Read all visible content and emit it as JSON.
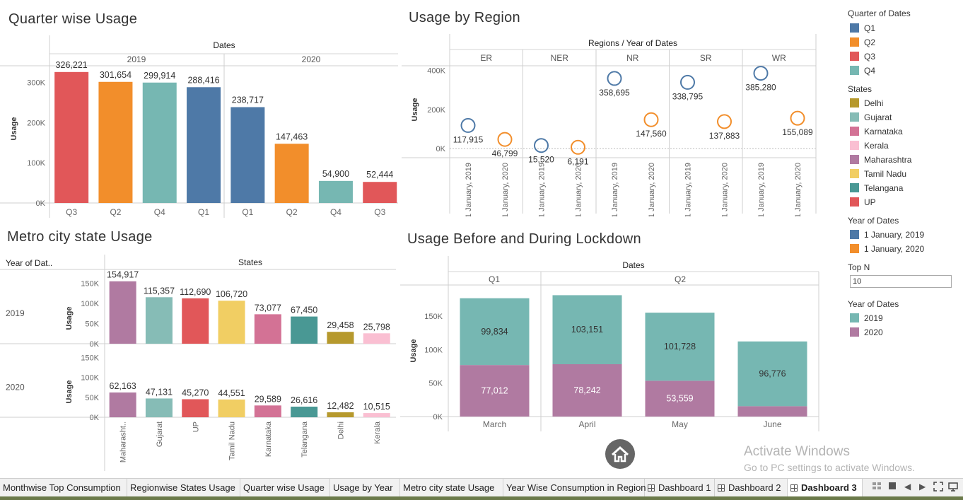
{
  "titles": {
    "quarter": "Quarter wise Usage",
    "region": "Usage by Region",
    "metro": "Metro city state Usage",
    "lockdown": "Usage Before and During Lockdown"
  },
  "chart_data": [
    {
      "id": "quarter",
      "type": "bar",
      "title": "Quarter wise Usage",
      "header": "Dates",
      "ylabel": "Usage",
      "ylim": [
        0,
        340000
      ],
      "yticks": [
        "0K",
        "100K",
        "200K",
        "300K"
      ],
      "groups": [
        {
          "name": "2019",
          "bars": [
            {
              "q": "Q3",
              "value": 326221,
              "label": "326,221",
              "color": "#e15759"
            },
            {
              "q": "Q2",
              "value": 301654,
              "label": "301,654",
              "color": "#f28e2b"
            },
            {
              "q": "Q4",
              "value": 299914,
              "label": "299,914",
              "color": "#76b7b2"
            },
            {
              "q": "Q1",
              "value": 288416,
              "label": "288,416",
              "color": "#4e79a7"
            }
          ]
        },
        {
          "name": "2020",
          "bars": [
            {
              "q": "Q1",
              "value": 238717,
              "label": "238,717",
              "color": "#4e79a7"
            },
            {
              "q": "Q2",
              "value": 147463,
              "label": "147,463",
              "color": "#f28e2b"
            },
            {
              "q": "Q4",
              "value": 54900,
              "label": "54,900",
              "color": "#76b7b2"
            },
            {
              "q": "Q3",
              "value": 52444,
              "label": "52,444",
              "color": "#e15759"
            }
          ]
        }
      ]
    },
    {
      "id": "region",
      "type": "scatter",
      "title": "Usage by Region",
      "header": "Regions / Year of Dates",
      "ylabel": "Usage",
      "ylim": [
        -20000,
        440000
      ],
      "yticks": [
        "0K",
        "200K",
        "400K"
      ],
      "x_labels": [
        "1 January, 2019",
        "1 January, 2020"
      ],
      "regions": [
        {
          "name": "ER",
          "points": [
            {
              "value": 117915,
              "label": "117,915",
              "year": "2019"
            },
            {
              "value": 46799,
              "label": "46,799",
              "year": "2020"
            }
          ]
        },
        {
          "name": "NER",
          "points": [
            {
              "value": 15520,
              "label": "15,520",
              "year": "2019"
            },
            {
              "value": 6191,
              "label": "6,191",
              "year": "2020"
            }
          ]
        },
        {
          "name": "NR",
          "points": [
            {
              "value": 358695,
              "label": "358,695",
              "year": "2019"
            },
            {
              "value": 147560,
              "label": "147,560",
              "year": "2020"
            }
          ]
        },
        {
          "name": "SR",
          "points": [
            {
              "value": 338795,
              "label": "338,795",
              "year": "2019"
            },
            {
              "value": 137883,
              "label": "137,883",
              "year": "2020"
            }
          ]
        },
        {
          "name": "WR",
          "points": [
            {
              "value": 385280,
              "label": "385,280",
              "year": "2019"
            },
            {
              "value": 155089,
              "label": "155,089",
              "year": "2020"
            }
          ]
        }
      ],
      "colors": {
        "2019": "#4e79a7",
        "2020": "#f28e2b"
      }
    },
    {
      "id": "metro",
      "type": "bar",
      "title": "Metro city state Usage",
      "header": "States",
      "row_header": "Year of Dat..",
      "ylabel": "Usage",
      "ylim": [
        0,
        165000
      ],
      "yticks": [
        "0K",
        "50K",
        "100K",
        "150K"
      ],
      "categories": [
        "Maharasht..",
        "Gujarat",
        "UP",
        "Tamil Nadu",
        "Karnataka",
        "Telangana",
        "Delhi",
        "Kerala"
      ],
      "colors": [
        "#b07aa1",
        "#86bcb6",
        "#e15759",
        "#f1ce63",
        "#d37295",
        "#499894",
        "#b6992d",
        "#fabfd2"
      ],
      "rows": [
        {
          "name": "2019",
          "values": [
            154917,
            115357,
            112690,
            106720,
            73077,
            67450,
            29458,
            25798
          ],
          "labels": [
            "154,917",
            "115,357",
            "112,690",
            "106,720",
            "73,077",
            "67,450",
            "29,458",
            "25,798"
          ]
        },
        {
          "name": "2020",
          "values": [
            62163,
            47131,
            45270,
            44551,
            29589,
            26616,
            12482,
            10515
          ],
          "labels": [
            "62,163",
            "47,131",
            "45,270",
            "44,551",
            "29,589",
            "26,616",
            "12,482",
            "10,515"
          ]
        }
      ]
    },
    {
      "id": "lockdown",
      "type": "bar",
      "stacked": true,
      "title": "Usage Before and During Lockdown",
      "header": "Dates",
      "ylabel": "Usage",
      "ylim": [
        0,
        185000
      ],
      "yticks": [
        "0K",
        "50K",
        "100K",
        "150K"
      ],
      "quarters": [
        {
          "name": "Q1",
          "count": 1
        },
        {
          "name": "Q2",
          "count": 3
        }
      ],
      "categories": [
        "March",
        "April",
        "May",
        "June"
      ],
      "series": [
        {
          "name": "2020",
          "color": "#b07aa1",
          "values": [
            77012,
            78242,
            53559,
            15500
          ],
          "labels": [
            "77,012",
            "78,242",
            "53,559",
            ""
          ]
        },
        {
          "name": "2019",
          "color": "#76b7b2",
          "values": [
            99834,
            103151,
            101728,
            96776
          ],
          "labels": [
            "99,834",
            "103,151",
            "101,728",
            "96,776"
          ]
        }
      ]
    }
  ],
  "legend": {
    "quarter": {
      "title": "Quarter of Dates",
      "items": [
        {
          "label": "Q1",
          "color": "#4e79a7"
        },
        {
          "label": "Q2",
          "color": "#f28e2b"
        },
        {
          "label": "Q3",
          "color": "#e15759"
        },
        {
          "label": "Q4",
          "color": "#76b7b2"
        }
      ]
    },
    "states": {
      "title": "States",
      "items": [
        {
          "label": "Delhi",
          "color": "#b6992d"
        },
        {
          "label": "Gujarat",
          "color": "#86bcb6"
        },
        {
          "label": "Karnataka",
          "color": "#d37295"
        },
        {
          "label": "Kerala",
          "color": "#fabfd2"
        },
        {
          "label": "Maharashtra",
          "color": "#b07aa1"
        },
        {
          "label": "Tamil Nadu",
          "color": "#f1ce63"
        },
        {
          "label": "Telangana",
          "color": "#499894"
        },
        {
          "label": "UP",
          "color": "#e15759"
        }
      ]
    },
    "year1": {
      "title": "Year of Dates",
      "items": [
        {
          "label": "1 January, 2019",
          "color": "#4e79a7"
        },
        {
          "label": "1 January, 2020",
          "color": "#f28e2b"
        }
      ]
    },
    "topn": {
      "title": "Top N",
      "value": "10"
    },
    "year2": {
      "title": "Year of Dates",
      "items": [
        {
          "label": "2019",
          "color": "#76b7b2"
        },
        {
          "label": "2020",
          "color": "#b07aa1"
        }
      ]
    }
  },
  "tabs": [
    "Monthwise Top Consumption",
    "Regionwise States Usage",
    "Quarter wise Usage",
    "Usage by Year",
    "Metro city state Usage",
    "Year Wise Consumption in Region",
    "Dashboard 1",
    "Dashboard 2",
    "Dashboard 3"
  ],
  "active_tab": "Dashboard 3",
  "watermark": {
    "line1": "Activate Windows",
    "line2": "Go to PC settings to activate Windows."
  },
  "icons": [
    "home-icon",
    "dashboard-icon",
    "sheet-grid-icon",
    "fullscreen-icon",
    "present-icon"
  ]
}
